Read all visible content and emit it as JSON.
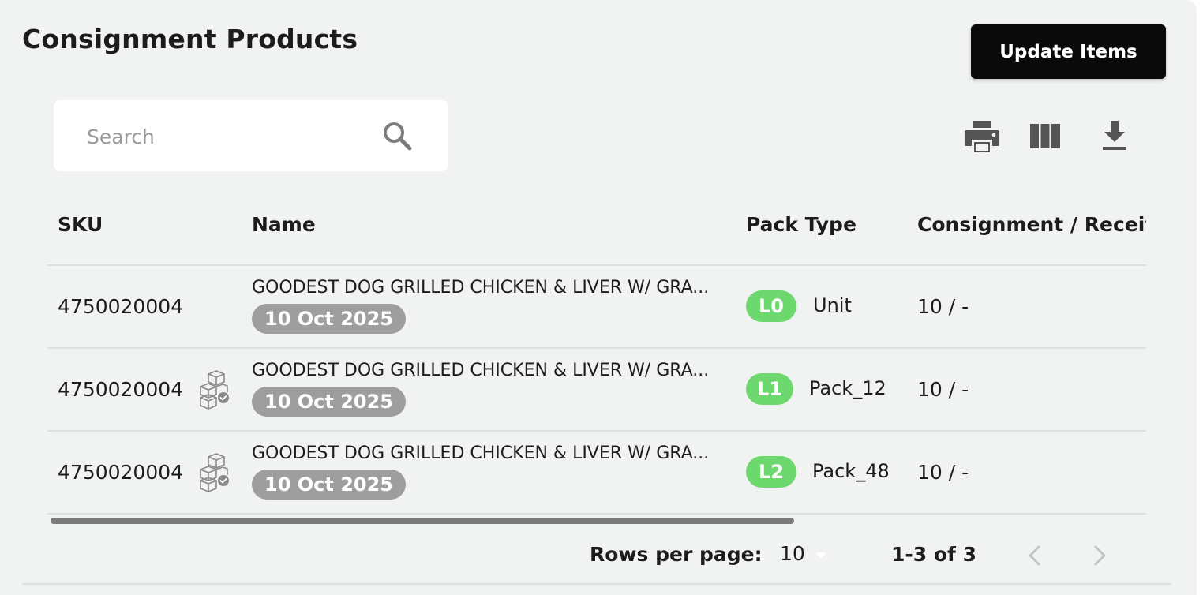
{
  "header": {
    "title": "Consignment Products",
    "update_button": "Update Items"
  },
  "search": {
    "placeholder": "Search",
    "icon": "search-icon"
  },
  "toolbar": {
    "icons": [
      "print-icon",
      "columns-icon",
      "download-icon"
    ]
  },
  "table": {
    "columns": [
      "SKU",
      "Name",
      "Pack Type",
      "Consignment / Receiv"
    ],
    "rows": [
      {
        "sku": "4750020004",
        "has_pack_icon": false,
        "name": "GOODEST DOG GRILLED CHICKEN & LIVER W/ GRA...",
        "date": "10 Oct 2025",
        "level": "L0",
        "pack_type": "Unit",
        "quantity": "10 / -"
      },
      {
        "sku": "4750020004",
        "has_pack_icon": true,
        "name": "GOODEST DOG GRILLED CHICKEN & LIVER W/ GRA...",
        "date": "10 Oct 2025",
        "level": "L1",
        "pack_type": "Pack_12",
        "quantity": "10 / -"
      },
      {
        "sku": "4750020004",
        "has_pack_icon": true,
        "name": "GOODEST DOG GRILLED CHICKEN & LIVER W/ GRA...",
        "date": "10 Oct 2025",
        "level": "L2",
        "pack_type": "Pack_48",
        "quantity": "10 / -"
      }
    ]
  },
  "pagination": {
    "rows_per_page_label": "Rows per page:",
    "rows_per_page_value": "10",
    "range": "1-3 of 3"
  },
  "colors": {
    "background": "#f0f3f2",
    "button": "#0a0a0a",
    "level_badge": "#6dd86d",
    "date_pill": "#9e9e9e"
  }
}
